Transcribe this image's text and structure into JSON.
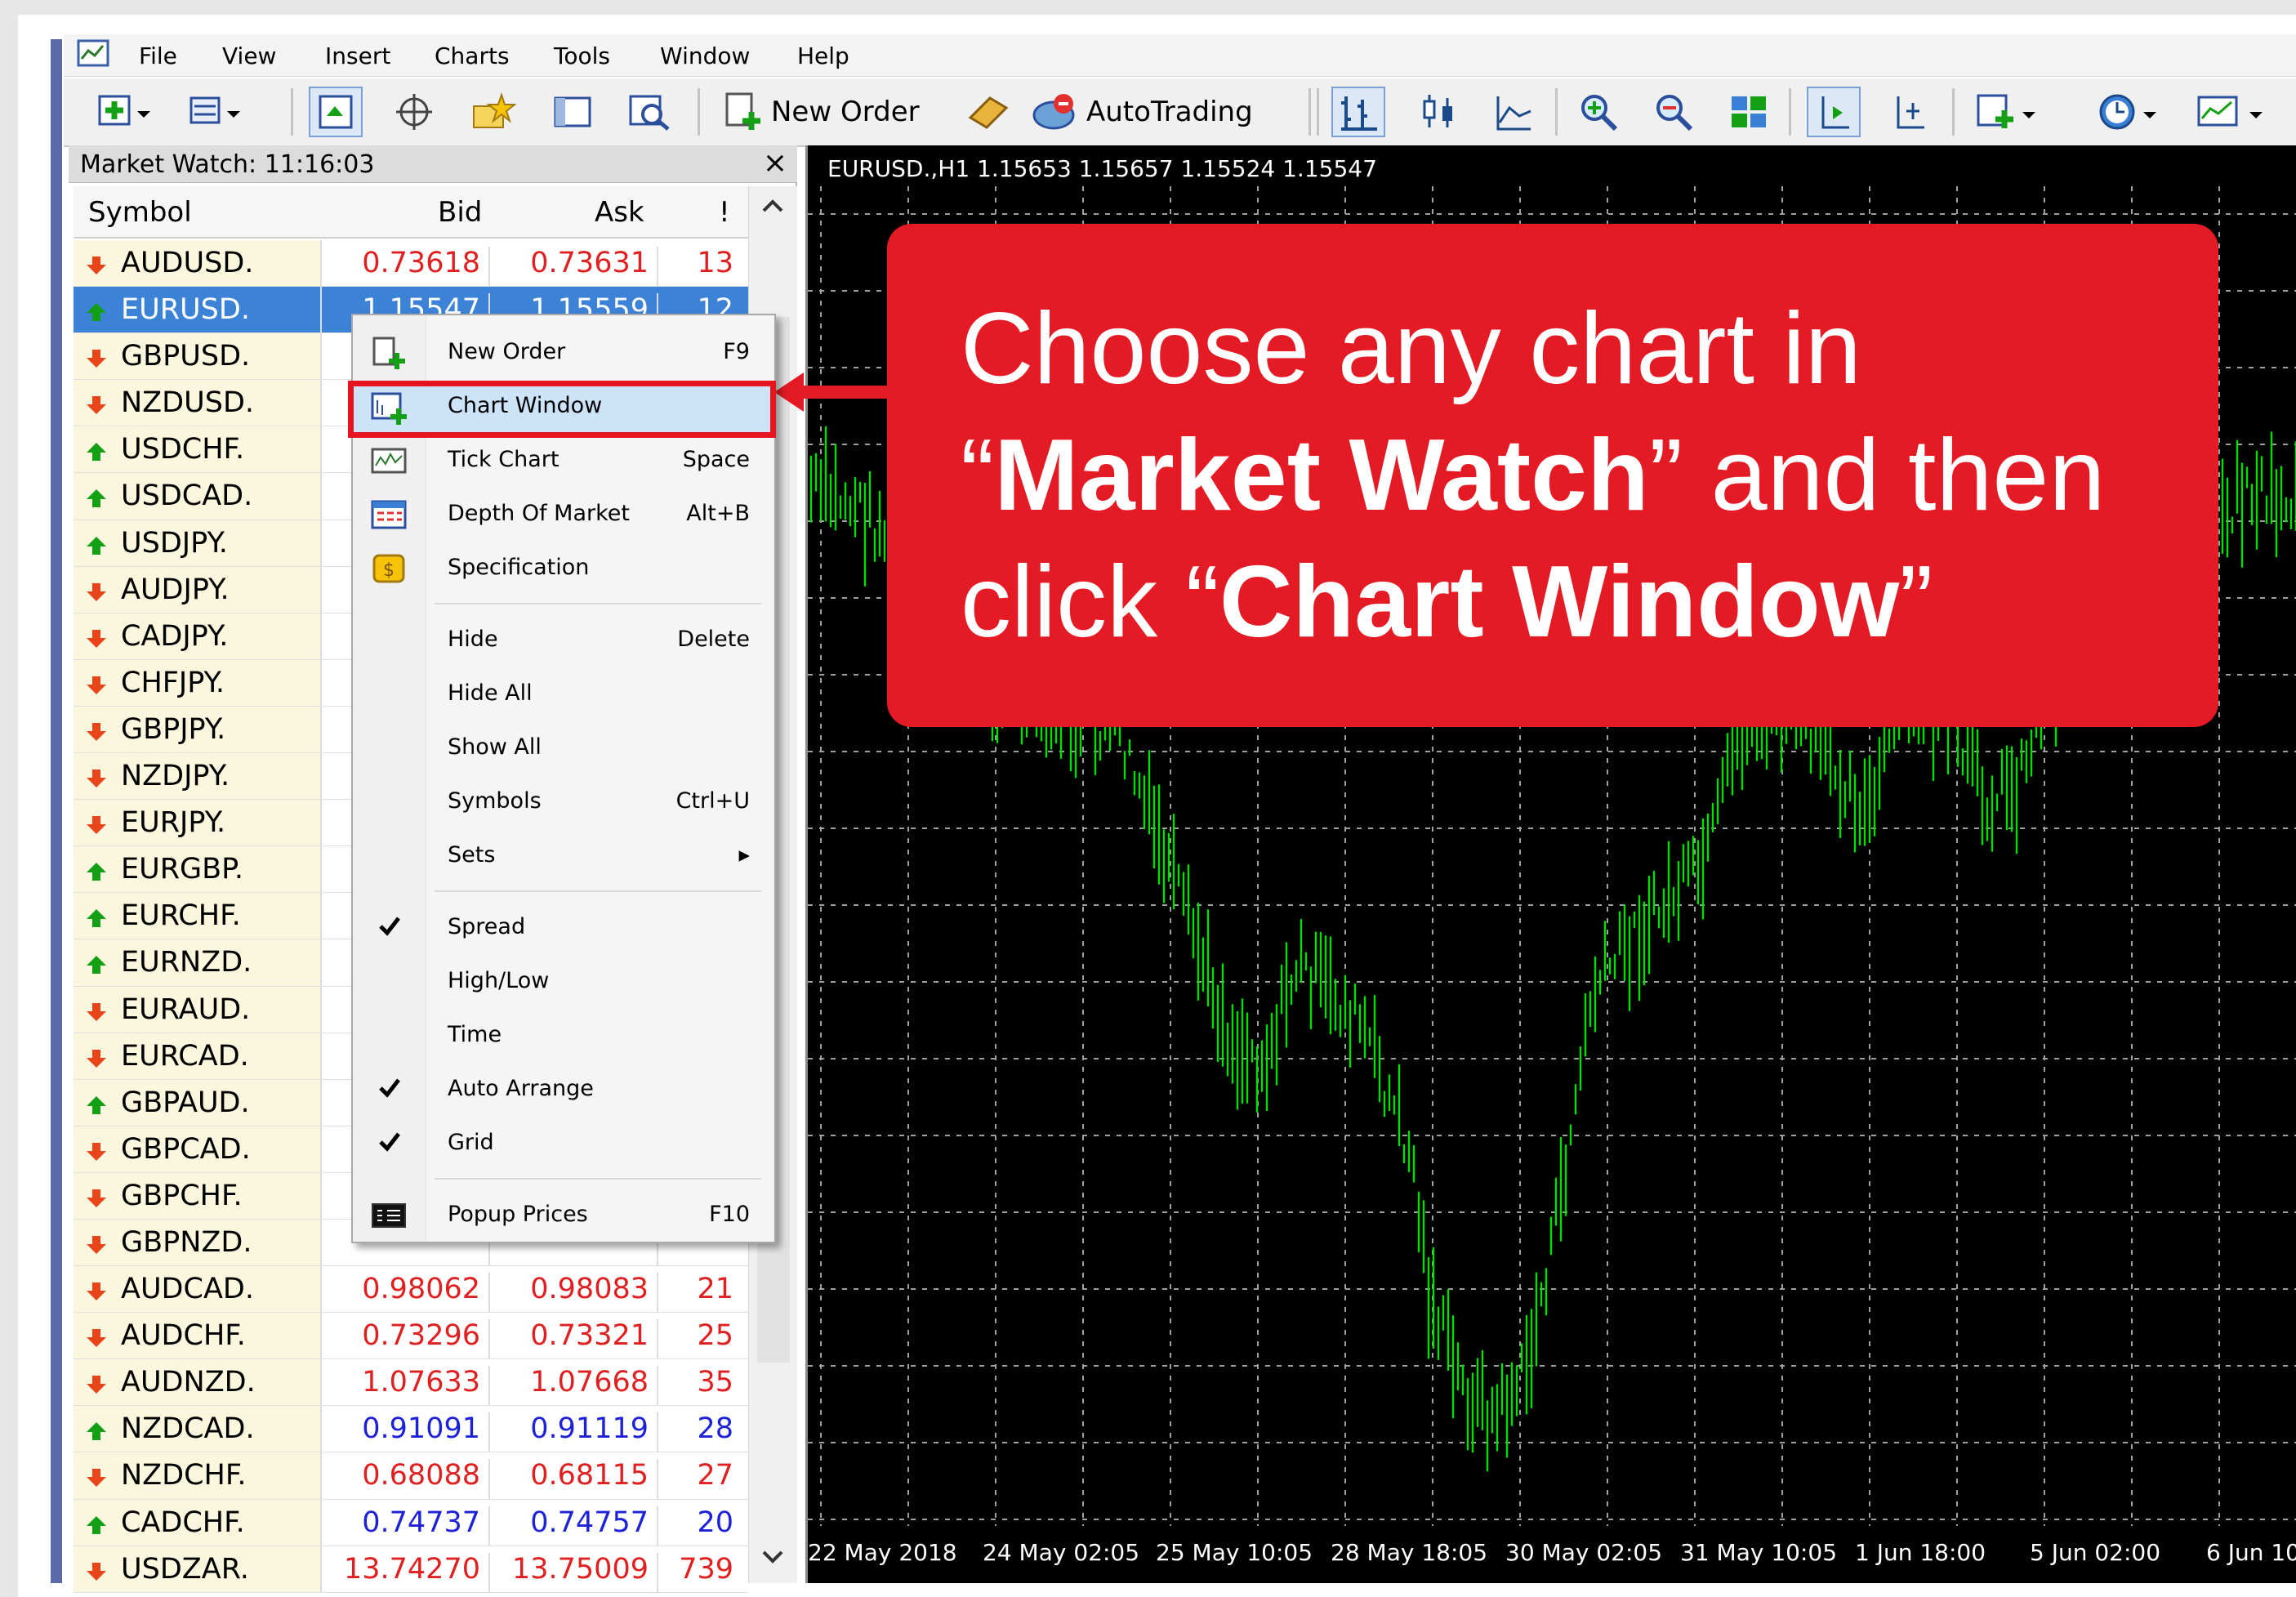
{
  "menubar": {
    "items": [
      "File",
      "View",
      "Insert",
      "Charts",
      "Tools",
      "Window",
      "Help"
    ]
  },
  "toolbar": {
    "new_order_label": "New Order",
    "autotrading_label": "AutoTrading",
    "icons": [
      "new-chart-icon",
      "profiles-icon",
      "market-watch-icon",
      "data-window-icon",
      "favorites-icon",
      "terminal-icon",
      "strategy-tester-icon",
      "new-order-icon",
      "metaeditor-icon",
      "autotrading-icon",
      "bar-chart-icon",
      "candlesticks-icon",
      "line-chart-icon",
      "zoom-in-icon",
      "zoom-out-icon",
      "tile-windows-icon",
      "chart-shift-icon",
      "autoscroll-icon",
      "indicators-icon",
      "periods-icon",
      "templates-icon"
    ]
  },
  "market_watch": {
    "title": "Market Watch: 11:16:03",
    "close": "×",
    "columns": {
      "symbol": "Symbol",
      "bid": "Bid",
      "ask": "Ask",
      "spread": "!"
    },
    "rows": [
      {
        "symbol": "AUDUSD.",
        "bid": "0.73618",
        "ask": "0.73631",
        "spread": "13",
        "dir": "down",
        "color": "red"
      },
      {
        "symbol": "EURUSD.",
        "bid": "1.15547",
        "ask": "1.15559",
        "spread": "12",
        "dir": "up",
        "color": "blue",
        "selected": true
      },
      {
        "symbol": "GBPUSD.",
        "bid": "",
        "ask": "",
        "spread": "",
        "dir": "down",
        "color": "red"
      },
      {
        "symbol": "NZDUSD.",
        "bid": "",
        "ask": "",
        "spread": "",
        "dir": "down",
        "color": "red"
      },
      {
        "symbol": "USDCHF.",
        "bid": "",
        "ask": "",
        "spread": "",
        "dir": "up",
        "color": "blue"
      },
      {
        "symbol": "USDCAD.",
        "bid": "",
        "ask": "",
        "spread": "",
        "dir": "up",
        "color": "blue"
      },
      {
        "symbol": "USDJPY.",
        "bid": "",
        "ask": "",
        "spread": "",
        "dir": "up",
        "color": "blue"
      },
      {
        "symbol": "AUDJPY.",
        "bid": "",
        "ask": "",
        "spread": "",
        "dir": "down",
        "color": "red"
      },
      {
        "symbol": "CADJPY.",
        "bid": "",
        "ask": "",
        "spread": "",
        "dir": "down",
        "color": "red"
      },
      {
        "symbol": "CHFJPY.",
        "bid": "",
        "ask": "",
        "spread": "",
        "dir": "down",
        "color": "red"
      },
      {
        "symbol": "GBPJPY.",
        "bid": "",
        "ask": "",
        "spread": "",
        "dir": "down",
        "color": "red"
      },
      {
        "symbol": "NZDJPY.",
        "bid": "",
        "ask": "",
        "spread": "",
        "dir": "down",
        "color": "red"
      },
      {
        "symbol": "EURJPY.",
        "bid": "",
        "ask": "",
        "spread": "",
        "dir": "down",
        "color": "red"
      },
      {
        "symbol": "EURGBP.",
        "bid": "",
        "ask": "",
        "spread": "",
        "dir": "up",
        "color": "blue"
      },
      {
        "symbol": "EURCHF.",
        "bid": "",
        "ask": "",
        "spread": "",
        "dir": "up",
        "color": "blue"
      },
      {
        "symbol": "EURNZD.",
        "bid": "",
        "ask": "",
        "spread": "",
        "dir": "up",
        "color": "blue"
      },
      {
        "symbol": "EURAUD.",
        "bid": "",
        "ask": "",
        "spread": "",
        "dir": "down",
        "color": "red"
      },
      {
        "symbol": "EURCAD.",
        "bid": "",
        "ask": "",
        "spread": "",
        "dir": "down",
        "color": "red"
      },
      {
        "symbol": "GBPAUD.",
        "bid": "",
        "ask": "",
        "spread": "",
        "dir": "up",
        "color": "blue"
      },
      {
        "symbol": "GBPCAD.",
        "bid": "",
        "ask": "",
        "spread": "",
        "dir": "down",
        "color": "red"
      },
      {
        "symbol": "GBPCHF.",
        "bid": "",
        "ask": "",
        "spread": "",
        "dir": "down",
        "color": "red"
      },
      {
        "symbol": "GBPNZD.",
        "bid": "",
        "ask": "",
        "spread": "",
        "dir": "down",
        "color": "red"
      },
      {
        "symbol": "AUDCAD.",
        "bid": "0.98062",
        "ask": "0.98083",
        "spread": "21",
        "dir": "down",
        "color": "red"
      },
      {
        "symbol": "AUDCHF.",
        "bid": "0.73296",
        "ask": "0.73321",
        "spread": "25",
        "dir": "down",
        "color": "red"
      },
      {
        "symbol": "AUDNZD.",
        "bid": "1.07633",
        "ask": "1.07668",
        "spread": "35",
        "dir": "down",
        "color": "red"
      },
      {
        "symbol": "NZDCAD.",
        "bid": "0.91091",
        "ask": "0.91119",
        "spread": "28",
        "dir": "up",
        "color": "blue"
      },
      {
        "symbol": "NZDCHF.",
        "bid": "0.68088",
        "ask": "0.68115",
        "spread": "27",
        "dir": "down",
        "color": "red"
      },
      {
        "symbol": "CADCHF.",
        "bid": "0.74737",
        "ask": "0.74757",
        "spread": "20",
        "dir": "up",
        "color": "blue"
      },
      {
        "symbol": "USDZAR.",
        "bid": "13.74270",
        "ask": "13.75009",
        "spread": "739",
        "dir": "down",
        "color": "red"
      }
    ]
  },
  "context_menu": {
    "items": [
      {
        "label": "New Order",
        "shortcut": "F9",
        "icon": "new-order-icon"
      },
      {
        "label": "Chart Window",
        "shortcut": "",
        "icon": "chart-window-icon",
        "highlighted": true
      },
      {
        "label": "Tick Chart",
        "shortcut": "Space",
        "icon": "tick-chart-icon"
      },
      {
        "label": "Depth Of Market",
        "shortcut": "Alt+B",
        "icon": "depth-of-market-icon"
      },
      {
        "label": "Specification",
        "shortcut": "",
        "icon": "specification-icon"
      },
      {
        "label": "Hide",
        "shortcut": "Delete"
      },
      {
        "label": "Hide All",
        "shortcut": ""
      },
      {
        "label": "Show All",
        "shortcut": ""
      },
      {
        "label": "Symbols",
        "shortcut": "Ctrl+U"
      },
      {
        "label": "Sets",
        "shortcut": "▸"
      },
      {
        "label": "Spread",
        "shortcut": "",
        "checked": true
      },
      {
        "label": "High/Low",
        "shortcut": ""
      },
      {
        "label": "Time",
        "shortcut": ""
      },
      {
        "label": "Auto Arrange",
        "shortcut": "",
        "checked": true
      },
      {
        "label": "Grid",
        "shortcut": "",
        "checked": true
      },
      {
        "label": "Popup Prices",
        "shortcut": "F10",
        "icon": "popup-prices-icon"
      }
    ]
  },
  "chart": {
    "title": "EURUSD.,H1  1.15653 1.15657 1.15524 1.15547",
    "x_labels": [
      "22 May 2018",
      "24 May 02:05",
      "25 May 10:05",
      "28 May 18:05",
      "30 May 02:05",
      "31 May 10:05",
      "1 Jun 18:00",
      "5 Jun 02:00",
      "6 Jun 10"
    ],
    "bar_color": "#00e000",
    "background": "#000000"
  },
  "callout": {
    "line1": "Choose any chart in",
    "q_open": "“",
    "bold1": "Market Watch",
    "mid": "” and then",
    "line3_pre": "click “",
    "bold2": "Chart Window",
    "q_close": "”",
    "color": "#e41b24"
  }
}
